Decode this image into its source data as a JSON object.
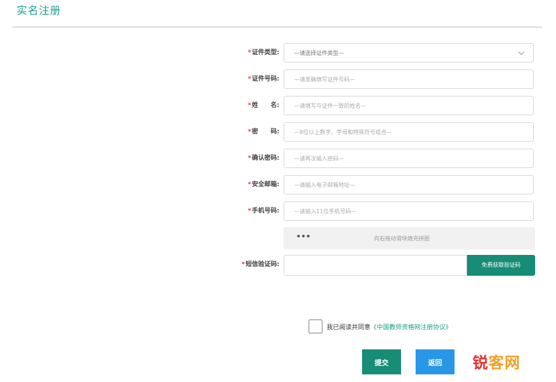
{
  "page": {
    "title": "实名注册"
  },
  "form": {
    "fields": [
      {
        "label": "证件类型:",
        "placeholder": "—请选择证件类型—",
        "type": "select"
      },
      {
        "label": "证件号码:",
        "placeholder": "—请准确填写证件号码—",
        "type": "text"
      },
      {
        "label": "姓　　名:",
        "placeholder": "—请填写与证件一致的姓名—",
        "type": "text"
      },
      {
        "label": "密　　码:",
        "placeholder": "—8位以上数字、字母和特殊符号组合—",
        "type": "password"
      },
      {
        "label": "确认密码:",
        "placeholder": "—请再次输入密码—",
        "type": "password"
      },
      {
        "label": "安全邮箱:",
        "placeholder": "—请输入电子邮箱地址—",
        "type": "text"
      },
      {
        "label": "手机号码:",
        "placeholder": "—请输入11位手机号码—",
        "type": "text"
      }
    ],
    "required_marker": "*",
    "captcha": {
      "dots": "•••",
      "hint": "向右拖动滑块填充拼图"
    },
    "sms": {
      "label": "短信验证码:",
      "button_label": "免费获取验证码"
    },
    "agreement": {
      "text": "我已阅读并同意",
      "link": "《中国教师资格网注册协议》"
    },
    "buttons": {
      "submit": "提交",
      "back": "返回"
    }
  },
  "watermark": {
    "part1": "锐",
    "part2": "客网"
  }
}
